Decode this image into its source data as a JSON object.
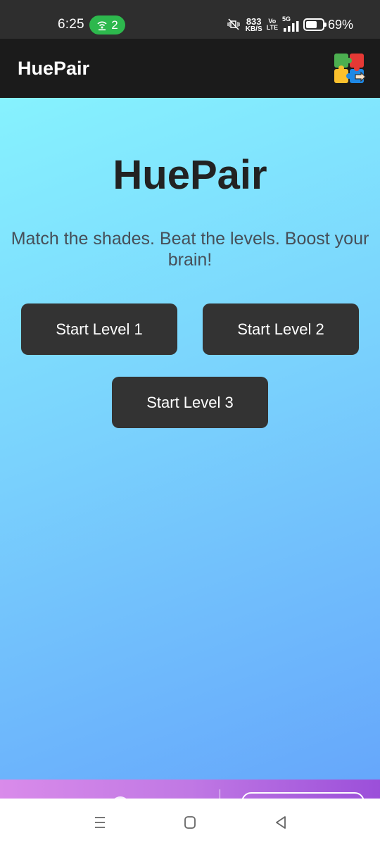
{
  "status_bar": {
    "time": "6:25",
    "hotspot_count": "2",
    "net_speed_value": "833",
    "net_speed_unit": "KB/S",
    "volte_top": "Vo",
    "volte_bottom": "LTE",
    "network_type": "5G",
    "battery_percent": "69%",
    "battery_level": 0.69,
    "hotspot_color": "#2db84d"
  },
  "app_bar": {
    "title": "HuePair",
    "logo_icon": "puzzle-pieces-icon"
  },
  "main": {
    "heading": "HuePair",
    "tagline": "Match the shades. Beat the levels. Boost your brain!",
    "buttons": [
      {
        "label": "Start Level 1"
      },
      {
        "label": "Start Level 2"
      },
      {
        "label": "Start Level 3"
      }
    ],
    "gradient_colors": [
      "#86f2fe",
      "#66a7fb"
    ]
  },
  "nav_bar": {
    "icons": [
      "recent-apps-icon",
      "home-icon",
      "back-icon"
    ]
  }
}
